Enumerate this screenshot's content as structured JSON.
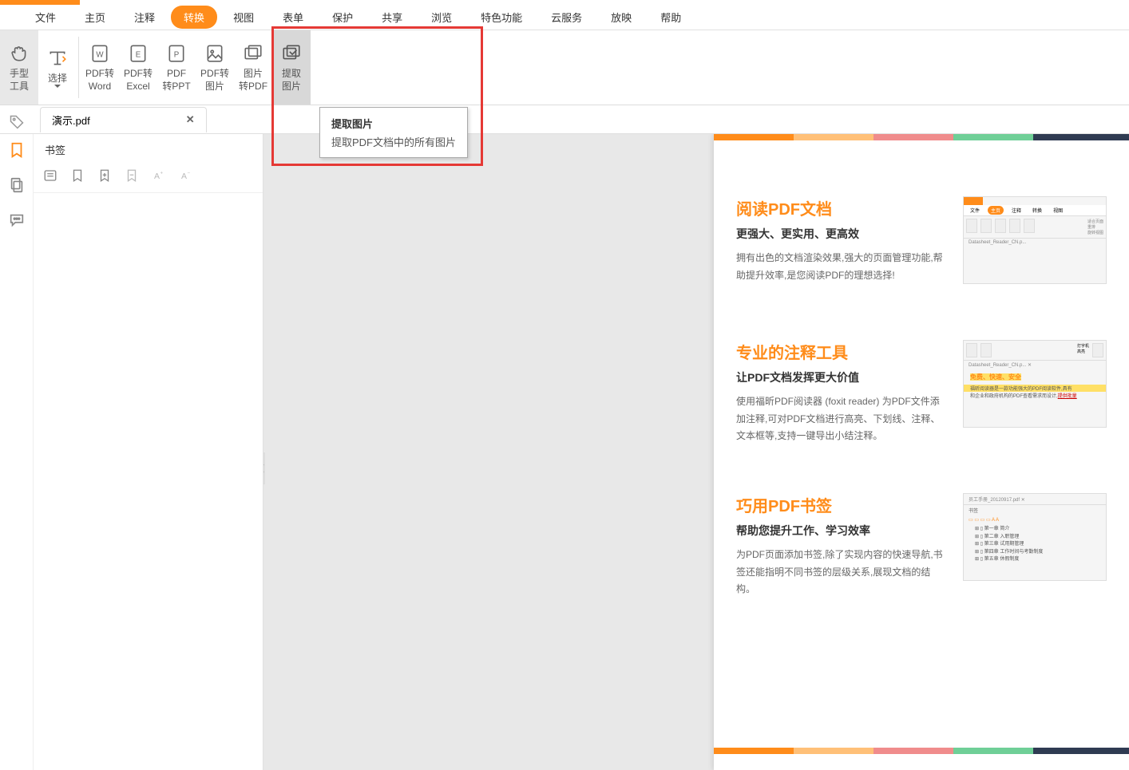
{
  "accent": "#ff8c1a",
  "menu": [
    "文件",
    "主页",
    "注释",
    "转换",
    "视图",
    "表单",
    "保护",
    "共享",
    "浏览",
    "特色功能",
    "云服务",
    "放映",
    "帮助"
  ],
  "menu_active": "转换",
  "ribbon": [
    {
      "id": "hand-tool",
      "label": "手型\n工具",
      "selected": true
    },
    {
      "id": "select-tool",
      "label": "选择",
      "dropdown": true,
      "sep_after": true
    },
    {
      "id": "pdf-to-word",
      "label": "PDF转\nWord"
    },
    {
      "id": "pdf-to-excel",
      "label": "PDF转\nExcel"
    },
    {
      "id": "pdf-to-ppt",
      "label": "PDF\n转PPT"
    },
    {
      "id": "pdf-to-image",
      "label": "PDF转\n图片"
    },
    {
      "id": "image-to-pdf",
      "label": "图片\n转PDF"
    },
    {
      "id": "extract-image",
      "label": "提取\n图片",
      "highlighted": true
    }
  ],
  "tooltip": {
    "title": "提取图片",
    "desc": "提取PDF文档中的所有图片"
  },
  "file_tab": {
    "name": "演示.pdf"
  },
  "bookmark": {
    "title": "书签"
  },
  "page": {
    "stripe_colors": [
      "#ff8c1a",
      "#ffc078",
      "#f08c8c",
      "#6fcf97",
      "#2f3b52"
    ],
    "features": [
      {
        "title": "阅读PDF文档",
        "sub": "更强大、更实用、更高效",
        "desc": "拥有出色的文档渲染效果,强大的页面管理功能,帮助提升效率,是您阅读PDF的理想选择!",
        "thumb_tab": "Datasheet_Reader_CN.p..."
      },
      {
        "title": "专业的注释工具",
        "sub": "让PDF文档发挥更大价值",
        "desc": "使用福昕PDF阅读器 (foxit reader) 为PDF文件添加注释,可对PDF文档进行高亮、下划线、注释、文本框等,支持一键导出小结注释。",
        "thumb_hl": "免费、快速、安全",
        "thumb_line": "福昕阅读器是一款功能强大的PDF阅读软件,具有"
      },
      {
        "title": "巧用PDF书签",
        "sub": "帮助您提升工作、学习效率",
        "desc": "为PDF页面添加书签,除了实现内容的快速导航,书签还能指明不同书签的层级关系,展现文档的结构。",
        "thumb_file": "员工手册_20120917.pdf",
        "thumb_chapters": [
          "第一章  简介",
          "第二章  入职管理",
          "第三章  试用期管理",
          "第四章  工作时间与考勤制度",
          "第五章  休假制度"
        ]
      }
    ]
  }
}
